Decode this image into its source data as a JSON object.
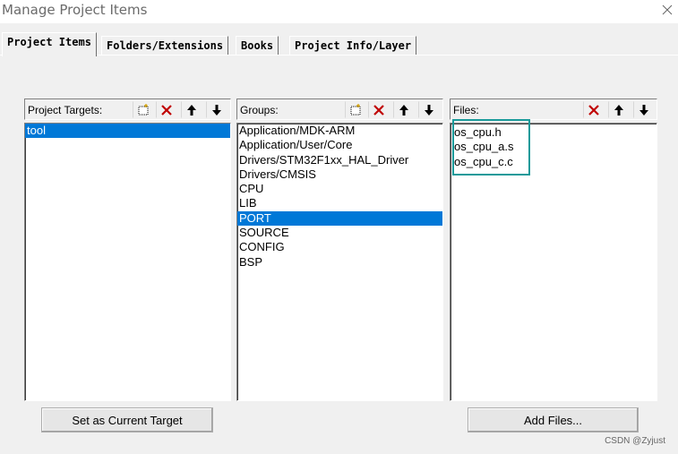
{
  "window": {
    "title": "Manage Project Items"
  },
  "tabs": [
    {
      "label": "Project Items",
      "active": true
    },
    {
      "label": "Folders/Extensions",
      "active": false
    },
    {
      "label": "Books",
      "active": false
    },
    {
      "label": "Project Info/Layer",
      "active": false
    }
  ],
  "targets": {
    "label": "Project Targets:",
    "items": [
      "tool"
    ],
    "selected_index": 0
  },
  "groups": {
    "label": "Groups:",
    "items": [
      "Application/MDK-ARM",
      "Application/User/Core",
      "Drivers/STM32F1xx_HAL_Driver",
      "Drivers/CMSIS",
      "CPU",
      "LIB",
      "PORT",
      "SOURCE",
      "CONFIG",
      "BSP"
    ],
    "selected_index": 6
  },
  "files": {
    "label": "Files:",
    "items": [
      "os_cpu.h",
      "os_cpu_a.s",
      "os_cpu_c.c"
    ]
  },
  "buttons": {
    "set_current_target": "Set as Current Target",
    "add_files": "Add Files..."
  },
  "watermark": "CSDN @Zyjust",
  "colors": {
    "selection": "#0078d7",
    "highlight_box": "#1a9a9a",
    "delete_icon": "#c00000"
  }
}
